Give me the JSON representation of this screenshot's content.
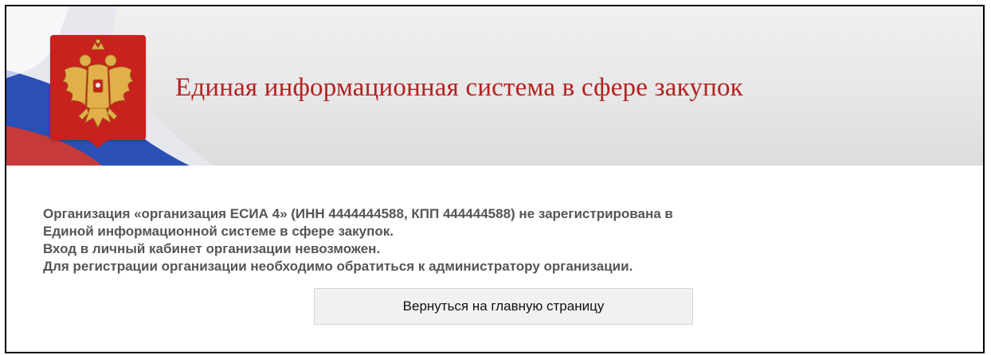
{
  "header": {
    "title": "Единая информационная система в сфере закупок",
    "emblem_icon": "double-headed-eagle-icon"
  },
  "message": {
    "lines": [
      "Организация «организация ЕСИА 4» (ИНН 4444444588, КПП 444444588) не зарегистрирована в",
      "Единой информационной системе в сфере закупок.",
      "Вход в личный кабинет организации невозможен.",
      "Для регистрации организации необходимо обратиться к администратору организации."
    ]
  },
  "actions": {
    "back_label": "Вернуться на главную страницу"
  },
  "colors": {
    "banner_title": "#b52121",
    "emblem_background": "#c8211e",
    "message_text": "#555555",
    "button_background": "#f1f1f1"
  }
}
